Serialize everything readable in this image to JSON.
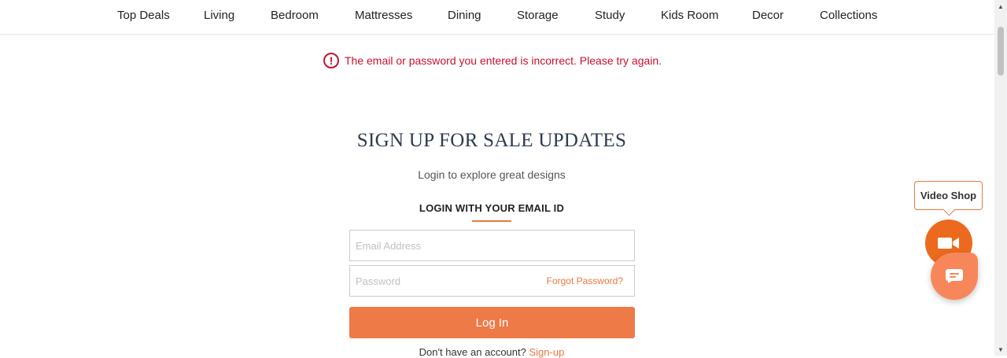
{
  "nav": {
    "items": [
      {
        "label": "Top Deals"
      },
      {
        "label": "Living"
      },
      {
        "label": "Bedroom"
      },
      {
        "label": "Mattresses"
      },
      {
        "label": "Dining"
      },
      {
        "label": "Storage"
      },
      {
        "label": "Study"
      },
      {
        "label": "Kids Room"
      },
      {
        "label": "Decor"
      },
      {
        "label": "Collections"
      }
    ]
  },
  "error": {
    "icon": "exclamation-circle-icon",
    "message": "The email or password you entered is incorrect. Please try again.",
    "color": "#c8102e"
  },
  "login": {
    "title": "SIGN UP FOR SALE UPDATES",
    "subtitle": "Login to explore great designs",
    "tab_label": "LOGIN WITH YOUR EMAIL ID",
    "email_placeholder": "Email Address",
    "email_value": "",
    "password_placeholder": "Password",
    "password_value": "",
    "forgot_label": "Forgot Password?",
    "button_label": "Log In",
    "signup_prompt": "Don't have an account?",
    "signup_link": "Sign-up"
  },
  "widgets": {
    "video_label": "Video Shop",
    "video_icon": "video-camera-icon",
    "chat_icon": "chat-bubble-icon"
  },
  "colors": {
    "accent": "#ee7a48",
    "heading": "#2e3b4e",
    "error": "#c8102e"
  }
}
